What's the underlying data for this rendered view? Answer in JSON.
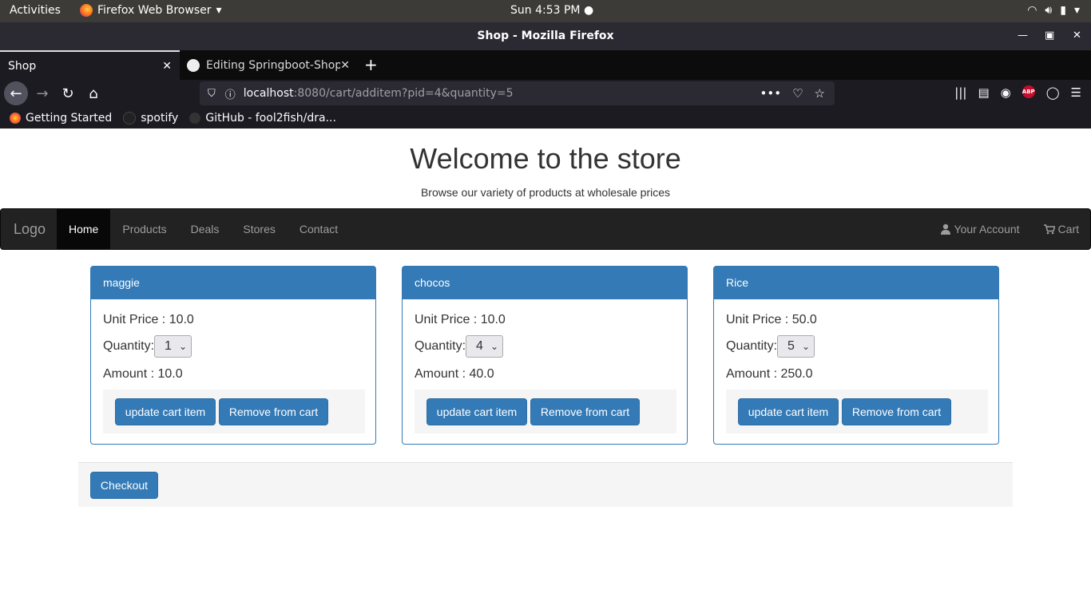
{
  "system": {
    "activities": "Activities",
    "app_name": "Firefox Web Browser",
    "clock": "Sun  4:53 PM"
  },
  "window": {
    "title": "Shop - Mozilla Firefox"
  },
  "tabs": [
    {
      "label": "Shop",
      "active": true
    },
    {
      "label": "Editing Springboot-Shop",
      "active": false
    }
  ],
  "url": {
    "host": "localhost",
    "rest": ":8080/cart/additem?pid=4&quantity=5"
  },
  "bookmarks": [
    {
      "label": "Getting Started"
    },
    {
      "label": "spotify"
    },
    {
      "label": "GitHub - fool2fish/dra..."
    }
  ],
  "page": {
    "heading": "Welcome to the store",
    "subheading": "Browse our variety of products at wholesale prices",
    "nav": {
      "brand": "Logo",
      "links": [
        "Home",
        "Products",
        "Deals",
        "Stores",
        "Contact"
      ],
      "account": "Your Account",
      "cart": "Cart"
    },
    "cart_items": [
      {
        "name": "maggie",
        "unit_price": "Unit Price : 10.0",
        "quantity_label": "Quantity:",
        "quantity": "1",
        "amount": "Amount : 10.0",
        "update_label": "update cart item",
        "remove_label": "Remove from cart"
      },
      {
        "name": "chocos",
        "unit_price": "Unit Price : 10.0",
        "quantity_label": "Quantity:",
        "quantity": "4",
        "amount": "Amount : 40.0",
        "update_label": "update cart item",
        "remove_label": "Remove from cart"
      },
      {
        "name": "Rice",
        "unit_price": "Unit Price : 50.0",
        "quantity_label": "Quantity:",
        "quantity": "5",
        "amount": "Amount : 250.0",
        "update_label": "update cart item",
        "remove_label": "Remove from cart"
      }
    ],
    "checkout_label": "Checkout"
  }
}
